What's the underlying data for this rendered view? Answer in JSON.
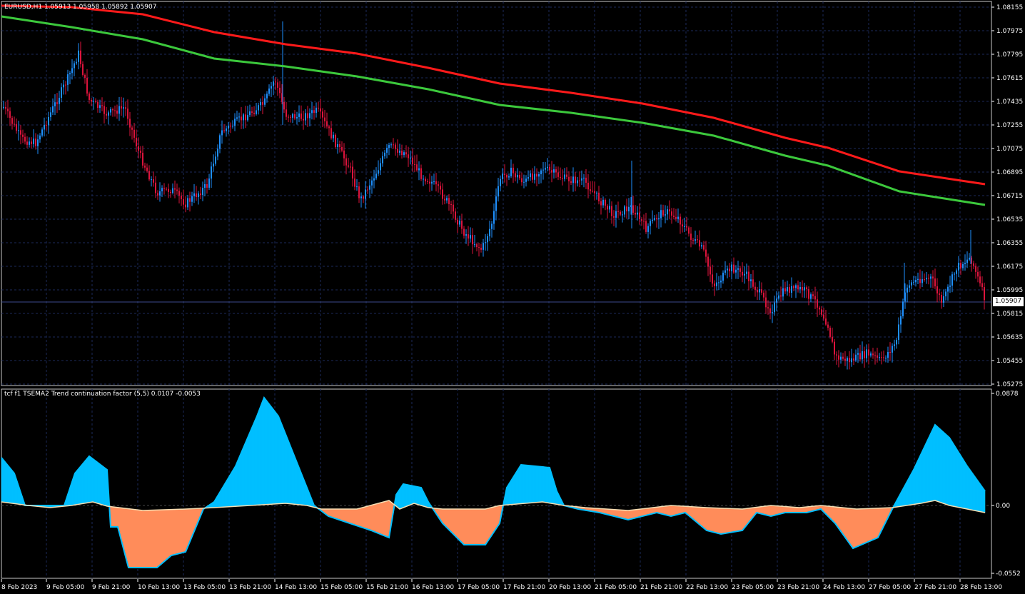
{
  "price_panel": {
    "header": "EURUSD,H1  1.05913 1.05958 1.05892 1.05907",
    "price_ticks": [
      "1.08155",
      "1.07975",
      "1.07795",
      "1.07615",
      "1.07435",
      "1.07255",
      "1.07075",
      "1.06895",
      "1.06715",
      "1.06535",
      "1.06355",
      "1.06175",
      "1.05995",
      "1.05815",
      "1.05635",
      "1.05455",
      "1.05275"
    ],
    "current_price": "1.05907",
    "colors": {
      "bull": "#1e90ff",
      "bear": "#dc143c",
      "ma_red": "#ff1a1a",
      "ma_green": "#3cc83c",
      "grid": "#1c2a5a"
    }
  },
  "indicator_panel": {
    "header": "tcf f1 TSEMA2 Trend continuation factor (5,5)  0.0107 -0.0053",
    "ticks": [
      "0.0878",
      "0.00",
      "-0.0552"
    ],
    "colors": {
      "positive": "#00bfff",
      "negative": "#ff8c5a",
      "lines": "#f5deb3"
    }
  },
  "time_axis": {
    "labels": [
      "8 Feb 2023",
      "9 Feb 05:00",
      "9 Feb 21:00",
      "10 Feb 13:00",
      "13 Feb 05:00",
      "13 Feb 21:00",
      "14 Feb 13:00",
      "15 Feb 05:00",
      "15 Feb 21:00",
      "16 Feb 13:00",
      "17 Feb 05:00",
      "17 Feb 21:00",
      "20 Feb 13:00",
      "21 Feb 05:00",
      "21 Feb 21:00",
      "22 Feb 13:00",
      "23 Feb 05:00",
      "23 Feb 21:00",
      "24 Feb 13:00",
      "27 Feb 05:00",
      "27 Feb 21:00",
      "28 Feb 13:00"
    ]
  }
}
